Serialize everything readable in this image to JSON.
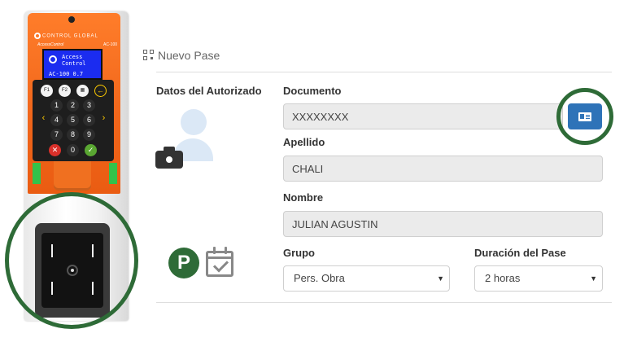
{
  "device": {
    "brand": "CONTROL GLOBAL",
    "product": "AccessControl",
    "model": "AC-100",
    "screen_title": "Access Control",
    "screen_version": "AC-100 0.7",
    "keys": [
      "F1",
      "F2",
      "1",
      "2",
      "3",
      "4",
      "5",
      "6",
      "7",
      "8",
      "9",
      "0"
    ]
  },
  "form": {
    "title": "Nuevo Pase",
    "section_label": "Datos del Autorizado",
    "documento": {
      "label": "Documento",
      "value": "XXXXXXXX"
    },
    "apellido": {
      "label": "Apellido",
      "value": "CHALI"
    },
    "nombre": {
      "label": "Nombre",
      "value": "JULIAN AGUSTIN"
    },
    "grupo": {
      "label": "Grupo",
      "selected": "Pers. Obra"
    },
    "duracion": {
      "label": "Duración del Pase",
      "selected": "2 horas"
    },
    "parking_letter": "P",
    "caret": "▼"
  },
  "colors": {
    "highlight_ring": "#2e6b37",
    "scan_button": "#2e73b8",
    "device_orange": "#f0651a"
  },
  "icons": [
    "qr-code-icon",
    "user-avatar-icon",
    "camera-icon",
    "id-card-icon",
    "parking-icon",
    "calendar-check-icon"
  ]
}
